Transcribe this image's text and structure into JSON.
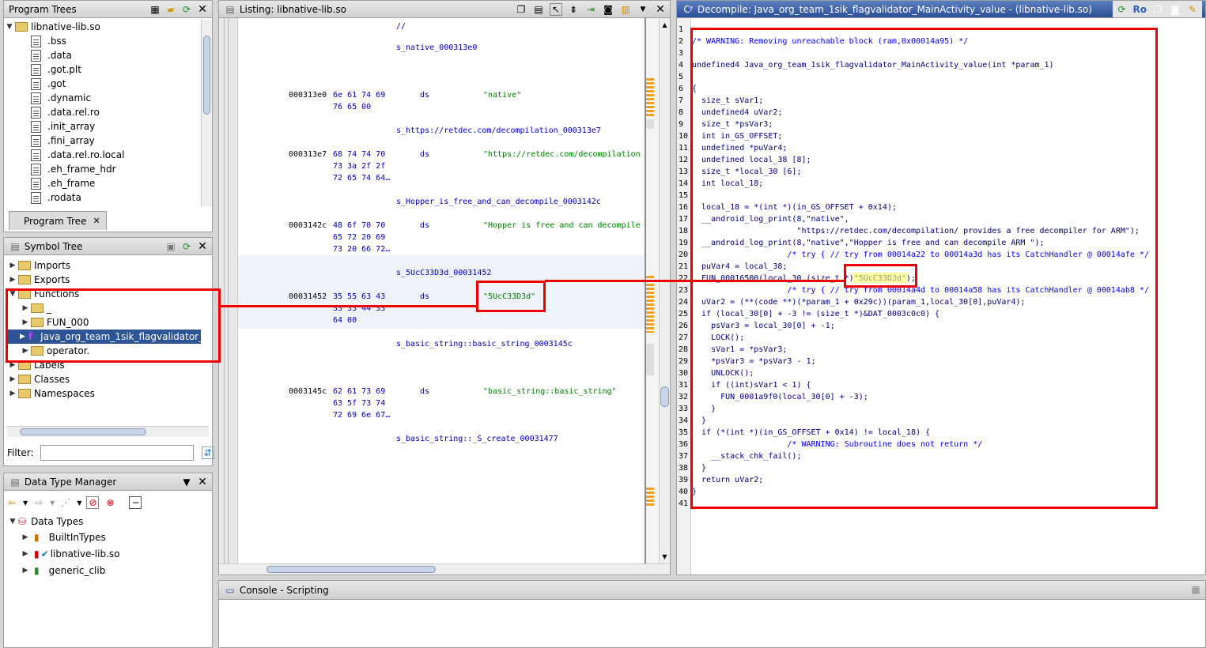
{
  "program_trees": {
    "title": "Program Trees",
    "root": "libnative-lib.so",
    "items": [
      ".bss",
      ".data",
      ".got.plt",
      ".got",
      ".dynamic",
      ".data.rel.ro",
      ".init_array",
      ".fini_array",
      ".data.rel.ro.local",
      ".eh_frame_hdr",
      ".eh_frame",
      ".rodata"
    ],
    "tab": "Program Tree"
  },
  "symbol_tree": {
    "title": "Symbol Tree",
    "items": {
      "imports": "Imports",
      "exports": "Exports",
      "functions": "Functions",
      "underscore": "_",
      "fun000": "FUN_000",
      "java": "Java_org_team_1sik_flagvalidator_M",
      "operator": "operator.",
      "labels": "Labels",
      "classes": "Classes",
      "namespaces": "Namespaces"
    },
    "filter_label": "Filter:"
  },
  "dtm": {
    "title": "Data Type Manager",
    "root": "Data Types",
    "items": [
      "BuiltInTypes",
      "libnative-lib.so",
      "generic_clib"
    ]
  },
  "listing": {
    "title": "Listing:  libnative-lib.so",
    "rows": [
      {
        "t": "lab",
        "text": "//"
      },
      {
        "t": "lab",
        "text": "s_native_000313e0"
      },
      {
        "t": "code",
        "addr": "000313e0",
        "hex": "6e 61 74 69",
        "mn": "ds",
        "op": "\"native\""
      },
      {
        "t": "hex",
        "text": "76 65 00"
      },
      {
        "t": "lab",
        "text": "s_https://retdec.com/decompilation_000313e7"
      },
      {
        "t": "code",
        "addr": "000313e7",
        "hex": "68 74 74 70",
        "mn": "ds",
        "op": "\"https://retdec.com/decompilation"
      },
      {
        "t": "hex",
        "text": "73 3a 2f 2f"
      },
      {
        "t": "hex",
        "text": "72 65 74 64…"
      },
      {
        "t": "lab",
        "text": "s_Hopper_is_free_and_can_decompile_0003142c"
      },
      {
        "t": "code",
        "addr": "0003142c",
        "hex": "48 6f 70 70",
        "mn": "ds",
        "op": "\"Hopper is free and can decompile"
      },
      {
        "t": "hex",
        "text": "65 72 20 69"
      },
      {
        "t": "hex",
        "text": "73 20 66 72…"
      },
      {
        "t": "lab",
        "text": "s_5UcC33D3d_00031452"
      },
      {
        "t": "code",
        "addr": "00031452",
        "hex": "35 55 63 43",
        "mn": "ds",
        "op": "\"5UcC33D3d\""
      },
      {
        "t": "hex",
        "text": "33 33 44 33"
      },
      {
        "t": "hex",
        "text": "64 00"
      },
      {
        "t": "lab",
        "text": "s_basic_string::basic_string_0003145c"
      },
      {
        "t": "code",
        "addr": "0003145c",
        "hex": "62 61 73 69",
        "mn": "ds",
        "op": "\"basic_string::basic_string\""
      },
      {
        "t": "hex",
        "text": "63 5f 73 74"
      },
      {
        "t": "hex",
        "text": "72 69 6e 67…"
      },
      {
        "t": "lab",
        "text": "s_basic_string::_S_create_00031477"
      }
    ]
  },
  "decompile": {
    "title": "Decompile: Java_org_team_1sik_flagvalidator_MainActivity_value -  (libnative-lib.so)",
    "ro": "Ro",
    "lines": [
      "",
      "/* WARNING: Removing unreachable block (ram,0x00014a95) */",
      "",
      "undefined4 Java_org_team_1sik_flagvalidator_MainActivity_value(int *param_1)",
      "",
      "{",
      "  size_t sVar1;",
      "  undefined4 uVar2;",
      "  size_t *psVar3;",
      "  int in_GS_OFFSET;",
      "  undefined *puVar4;",
      "  undefined local_38 [8];",
      "  size_t *local_30 [6];",
      "  int local_18;",
      "",
      "  local_18 = *(int *)(in_GS_OFFSET + 0x14);",
      "  __android_log_print(8,\"native\",",
      "                      \"https://retdec.com/decompilation/ provides a free decompiler for ARM\");",
      "  __android_log_print(8,\"native\",\"Hopper is free and can decompile ARM \");",
      "                    /* try { // try from 00014a22 to 00014a3d has its CatchHandler @ 00014afe */",
      "  puVar4 = local_38;",
      "  FUN_00016500(local_30,(size_t *)\"5UcC33D3d\");",
      "                    /* try { // try from 00014a4d to 00014a58 has its CatchHandler @ 00014ab8 */",
      "  uVar2 = (**(code **)(*param_1 + 0x29c))(param_1,local_30[0],puVar4);",
      "  if (local_30[0] + -3 != (size_t *)&DAT_0003c0c0) {",
      "    psVar3 = local_30[0] + -1;",
      "    LOCK();",
      "    sVar1 = *psVar3;",
      "    *psVar3 = *psVar3 - 1;",
      "    UNLOCK();",
      "    if ((int)sVar1 < 1) {",
      "      FUN_0001a9f0(local_30[0] + -3);",
      "    }",
      "  }",
      "  if (*(int *)(in_GS_OFFSET + 0x14) != local_18) {",
      "                    /* WARNING: Subroutine does not return */",
      "    __stack_chk_fail();",
      "  }",
      "  return uVar2;",
      "}",
      ""
    ]
  },
  "console": {
    "title": "Console - Scripting"
  }
}
